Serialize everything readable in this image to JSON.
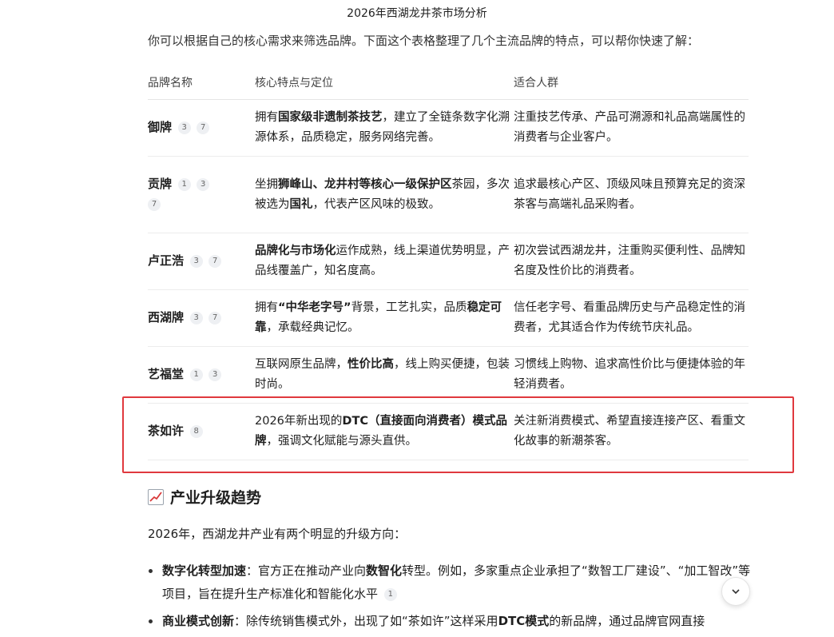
{
  "header": {
    "title": "2026年西湖龙井茶市场分析"
  },
  "intro": {
    "text": "你可以根据自己的核心需求来筛选品牌。下面这个表格整理了几个主流品牌的特点，可以帮你快速了解："
  },
  "table": {
    "headers": [
      "品牌名称",
      "核心特点与定位",
      "适合人群"
    ],
    "rows": [
      {
        "brand": "御牌",
        "cites": [
          "3",
          "7"
        ],
        "f1": "拥有",
        "f2": "国家级非遗制茶技艺",
        "f3": "，建立了全链条数字化溯源体系，品质稳定，服务网络完善。",
        "f4": "",
        "f5": "",
        "audience": "注重技艺传承、产品可溯源和礼品高端属性的消费者与企业客户。"
      },
      {
        "brand": "贡牌",
        "cites": [
          "1",
          "3",
          "7"
        ],
        "f1": "坐拥",
        "f2": "狮峰山、龙井村等核心一级保护区",
        "f3": "茶园，多次被选为",
        "f4": "国礼",
        "f5": "，代表产区风味的极致。",
        "audience": "追求最核心产区、顶级风味且预算充足的资深茶客与高端礼品采购者。"
      },
      {
        "brand": "卢正浩",
        "cites": [
          "3",
          "7"
        ],
        "f1": "",
        "f2": "品牌化与市场化",
        "f3": "运作成熟，线上渠道优势明显，产品线覆盖广，知名度高。",
        "f4": "",
        "f5": "",
        "audience": "初次尝试西湖龙井，注重购买便利性、品牌知名度及性价比的消费者。"
      },
      {
        "brand": "西湖牌",
        "cites": [
          "3",
          "7"
        ],
        "f1": "拥有",
        "f2": "“中华老字号”",
        "f3": "背景，工艺扎实，品质",
        "f4": "稳定可靠",
        "f5": "，承载经典记忆。",
        "audience": "信任老字号、看重品牌历史与产品稳定性的消费者，尤其适合作为传统节庆礼品。"
      },
      {
        "brand": "艺福堂",
        "cites": [
          "1",
          "3"
        ],
        "f1": "互联网原生品牌，",
        "f2": "性价比高",
        "f3": "，线上购买便捷，包装时尚。",
        "f4": "",
        "f5": "",
        "audience": "习惯线上购物、追求高性价比与便捷体验的年轻消费者。"
      },
      {
        "brand": "茶如许",
        "cites": [
          "8"
        ],
        "f1": "2026年新出现的",
        "f2": "DTC（直接面向消费者）模式品牌",
        "f3": "，强调文化赋能与源头直供。",
        "f4": "",
        "f5": "",
        "audience": "关注新消费模式、希望直接连接产区、看重文化故事的新潮茶客。"
      }
    ]
  },
  "section": {
    "title": "产业升级趋势",
    "icon": "chart-up-icon"
  },
  "para": {
    "text": "2026年，西湖龙井产业有两个明显的升级方向："
  },
  "trends": [
    {
      "bold": "数字化转型加速",
      "t1": "：官方正在推动产业向",
      "bold2": "数智化",
      "t2": "转型。例如，多家重点企业承担了“数智工厂建设”、“加工智改”等项目，旨在提升生产标准化和智能化水平",
      "cite": "1"
    },
    {
      "bold": "商业模式创新",
      "t1": "：除传统销售模式外，出现了如“茶如许”这样采用",
      "bold2": "DTC模式",
      "t2": "的新品牌，通过品牌官网直接",
      "cite": ""
    }
  ],
  "colors": {
    "highlight": "#e0393e",
    "text": "#1f1f1f",
    "citeBg": "#eef0f3"
  }
}
